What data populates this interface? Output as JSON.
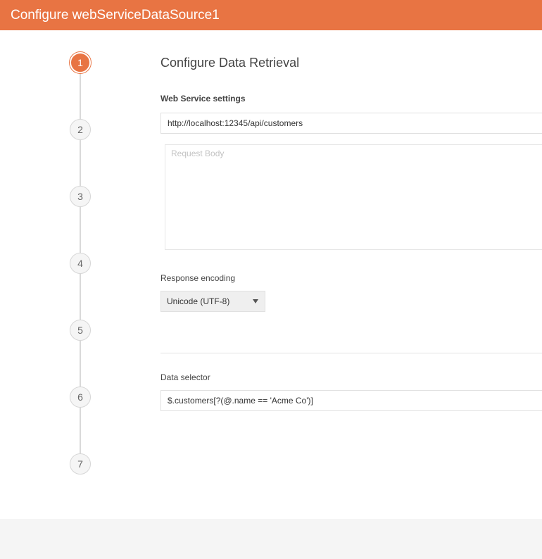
{
  "window": {
    "title": "Configure webServiceDataSource1"
  },
  "stepper": {
    "steps": [
      "1",
      "2",
      "3",
      "4",
      "5",
      "6",
      "7"
    ],
    "active_step": "1"
  },
  "main": {
    "heading": "Configure Data Retrieval",
    "web_service_label": "Web Service settings",
    "url_value": "http://localhost:12345/api/customers",
    "request_body_placeholder": "Request Body",
    "request_body_value": "",
    "response_encoding_label": "Response encoding",
    "response_encoding_selected": "Unicode (UTF-8)",
    "data_selector_label": "Data selector",
    "data_selector_value": "$.customers[?(@.name == 'Acme Co')]"
  },
  "colors": {
    "accent": "#e87443",
    "footer_bg": "#f5f5f5"
  },
  "icons": {
    "select_caret": "chevron-down-icon"
  }
}
